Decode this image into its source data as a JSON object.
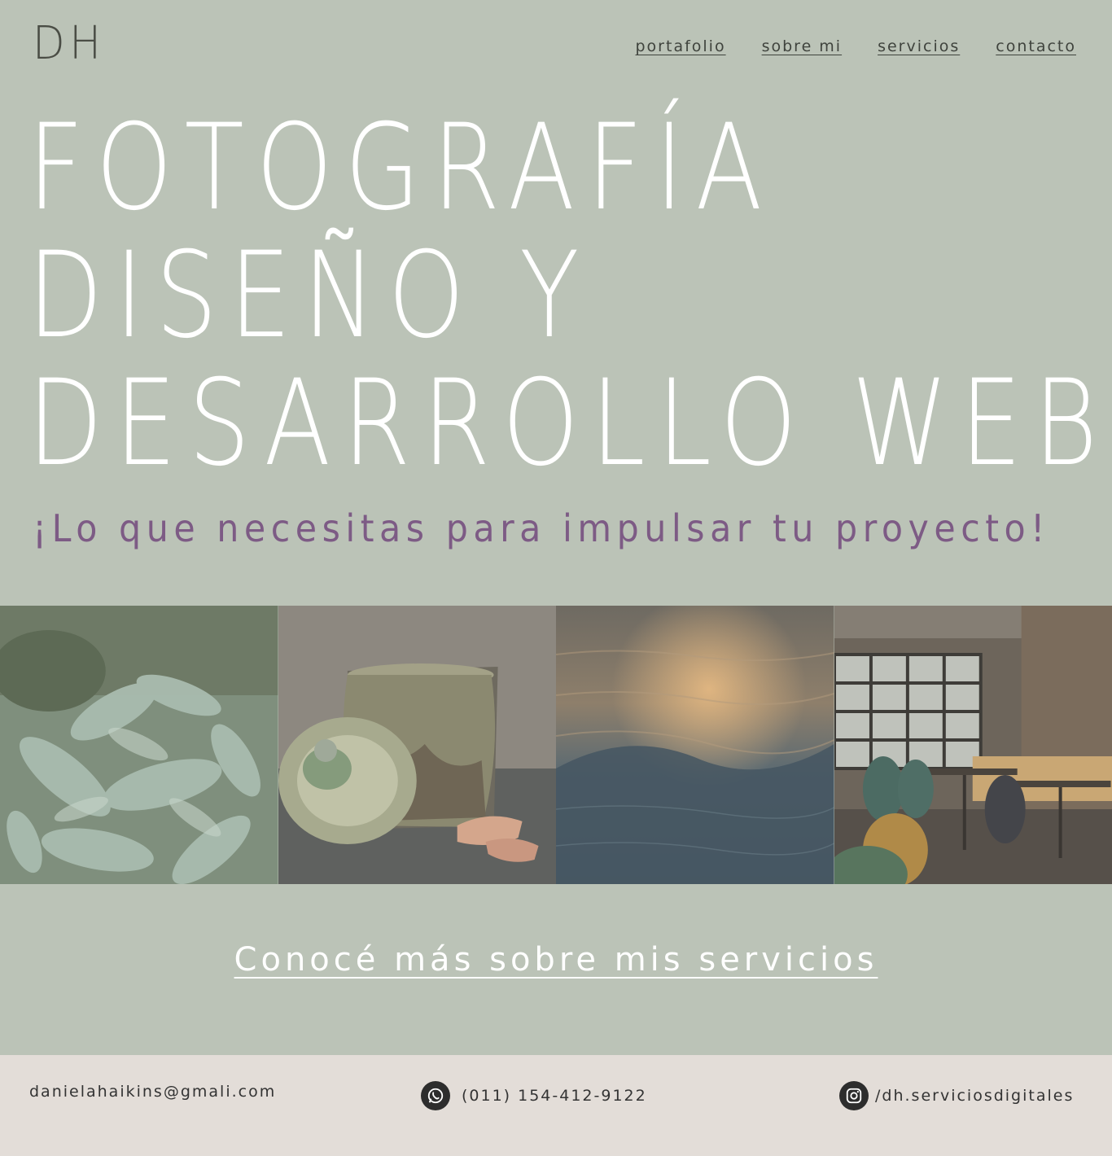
{
  "logo": "DH",
  "nav": {
    "items": [
      "portafolio",
      "sobre mi",
      "servicios",
      "contacto"
    ]
  },
  "hero": {
    "line1": "FOTOGRAFÍA",
    "line2": "DISEÑO Y",
    "line3": "DESARROLLO WEB"
  },
  "tagline": "¡Lo que necesitas para impulsar tu proyecto!",
  "gallery": {
    "images": [
      "leaves-photo",
      "ceramic-jar-photo",
      "sea-sunset-photo",
      "restaurant-interior-photo"
    ]
  },
  "cta": "Conocé más sobre mis servicios",
  "footer": {
    "email": "danielahaikins@gmali.com",
    "phone": "(011) 154-412-9122",
    "instagram": "/dh.serviciosdigitales",
    "icons": [
      "whatsapp-icon",
      "instagram-icon"
    ]
  },
  "colors": {
    "background": "#bbc3b7",
    "accent": "#7d5b85",
    "footer": "#e3ddd8"
  }
}
